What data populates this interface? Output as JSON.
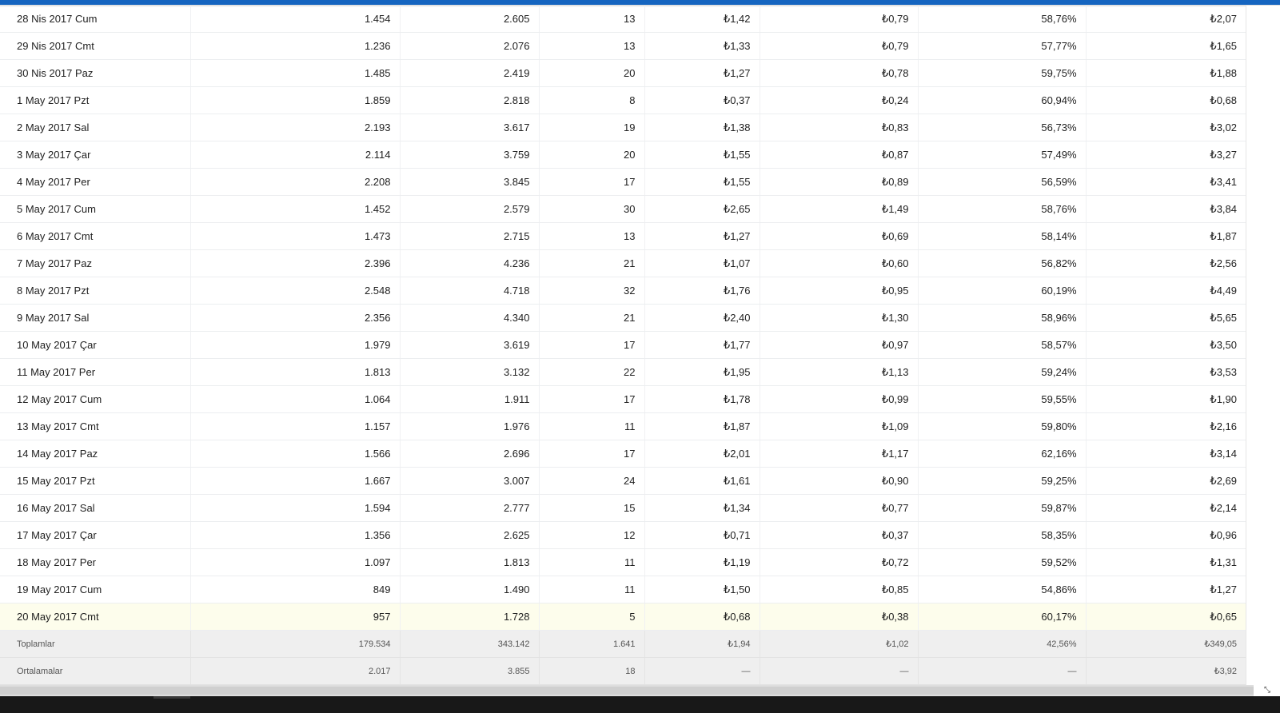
{
  "table": {
    "rows": [
      [
        "28 Nis 2017 Cum",
        "1.454",
        "2.605",
        "13",
        "₺1,42",
        "₺0,79",
        "58,76%",
        "₺2,07"
      ],
      [
        "29 Nis 2017 Cmt",
        "1.236",
        "2.076",
        "13",
        "₺1,33",
        "₺0,79",
        "57,77%",
        "₺1,65"
      ],
      [
        "30 Nis 2017 Paz",
        "1.485",
        "2.419",
        "20",
        "₺1,27",
        "₺0,78",
        "59,75%",
        "₺1,88"
      ],
      [
        "1 May 2017 Pzt",
        "1.859",
        "2.818",
        "8",
        "₺0,37",
        "₺0,24",
        "60,94%",
        "₺0,68"
      ],
      [
        "2 May 2017 Sal",
        "2.193",
        "3.617",
        "19",
        "₺1,38",
        "₺0,83",
        "56,73%",
        "₺3,02"
      ],
      [
        "3 May 2017 Çar",
        "2.114",
        "3.759",
        "20",
        "₺1,55",
        "₺0,87",
        "57,49%",
        "₺3,27"
      ],
      [
        "4 May 2017 Per",
        "2.208",
        "3.845",
        "17",
        "₺1,55",
        "₺0,89",
        "56,59%",
        "₺3,41"
      ],
      [
        "5 May 2017 Cum",
        "1.452",
        "2.579",
        "30",
        "₺2,65",
        "₺1,49",
        "58,76%",
        "₺3,84"
      ],
      [
        "6 May 2017 Cmt",
        "1.473",
        "2.715",
        "13",
        "₺1,27",
        "₺0,69",
        "58,14%",
        "₺1,87"
      ],
      [
        "7 May 2017 Paz",
        "2.396",
        "4.236",
        "21",
        "₺1,07",
        "₺0,60",
        "56,82%",
        "₺2,56"
      ],
      [
        "8 May 2017 Pzt",
        "2.548",
        "4.718",
        "32",
        "₺1,76",
        "₺0,95",
        "60,19%",
        "₺4,49"
      ],
      [
        "9 May 2017 Sal",
        "2.356",
        "4.340",
        "21",
        "₺2,40",
        "₺1,30",
        "58,96%",
        "₺5,65"
      ],
      [
        "10 May 2017 Çar",
        "1.979",
        "3.619",
        "17",
        "₺1,77",
        "₺0,97",
        "58,57%",
        "₺3,50"
      ],
      [
        "11 May 2017 Per",
        "1.813",
        "3.132",
        "22",
        "₺1,95",
        "₺1,13",
        "59,24%",
        "₺3,53"
      ],
      [
        "12 May 2017 Cum",
        "1.064",
        "1.911",
        "17",
        "₺1,78",
        "₺0,99",
        "59,55%",
        "₺1,90"
      ],
      [
        "13 May 2017 Cmt",
        "1.157",
        "1.976",
        "11",
        "₺1,87",
        "₺1,09",
        "59,80%",
        "₺2,16"
      ],
      [
        "14 May 2017 Paz",
        "1.566",
        "2.696",
        "17",
        "₺2,01",
        "₺1,17",
        "62,16%",
        "₺3,14"
      ],
      [
        "15 May 2017 Pzt",
        "1.667",
        "3.007",
        "24",
        "₺1,61",
        "₺0,90",
        "59,25%",
        "₺2,69"
      ],
      [
        "16 May 2017 Sal",
        "1.594",
        "2.777",
        "15",
        "₺1,34",
        "₺0,77",
        "59,87%",
        "₺2,14"
      ],
      [
        "17 May 2017 Çar",
        "1.356",
        "2.625",
        "12",
        "₺0,71",
        "₺0,37",
        "58,35%",
        "₺0,96"
      ],
      [
        "18 May 2017 Per",
        "1.097",
        "1.813",
        "11",
        "₺1,19",
        "₺0,72",
        "59,52%",
        "₺1,31"
      ],
      [
        "19 May 2017 Cum",
        "849",
        "1.490",
        "11",
        "₺1,50",
        "₺0,85",
        "54,86%",
        "₺1,27"
      ],
      [
        "20 May 2017 Cmt",
        "957",
        "1.728",
        "5",
        "₺0,68",
        "₺0,38",
        "60,17%",
        "₺0,65"
      ]
    ],
    "highlighted_row": 22,
    "summary": [
      [
        "Toplamlar",
        "179.534",
        "343.142",
        "1.641",
        "₺1,94",
        "₺1,02",
        "42,56%",
        "₺349,05"
      ],
      [
        "Ortalamalar",
        "2.017",
        "3.855",
        "18",
        "—",
        "—",
        "—",
        "₺3,92"
      ]
    ]
  },
  "colors": {
    "accent": "#1565c0",
    "highlight_row": "#fdfdec",
    "summary_row": "#efefef"
  },
  "icons": {
    "scroll_corner": "resize-corner-icon"
  }
}
